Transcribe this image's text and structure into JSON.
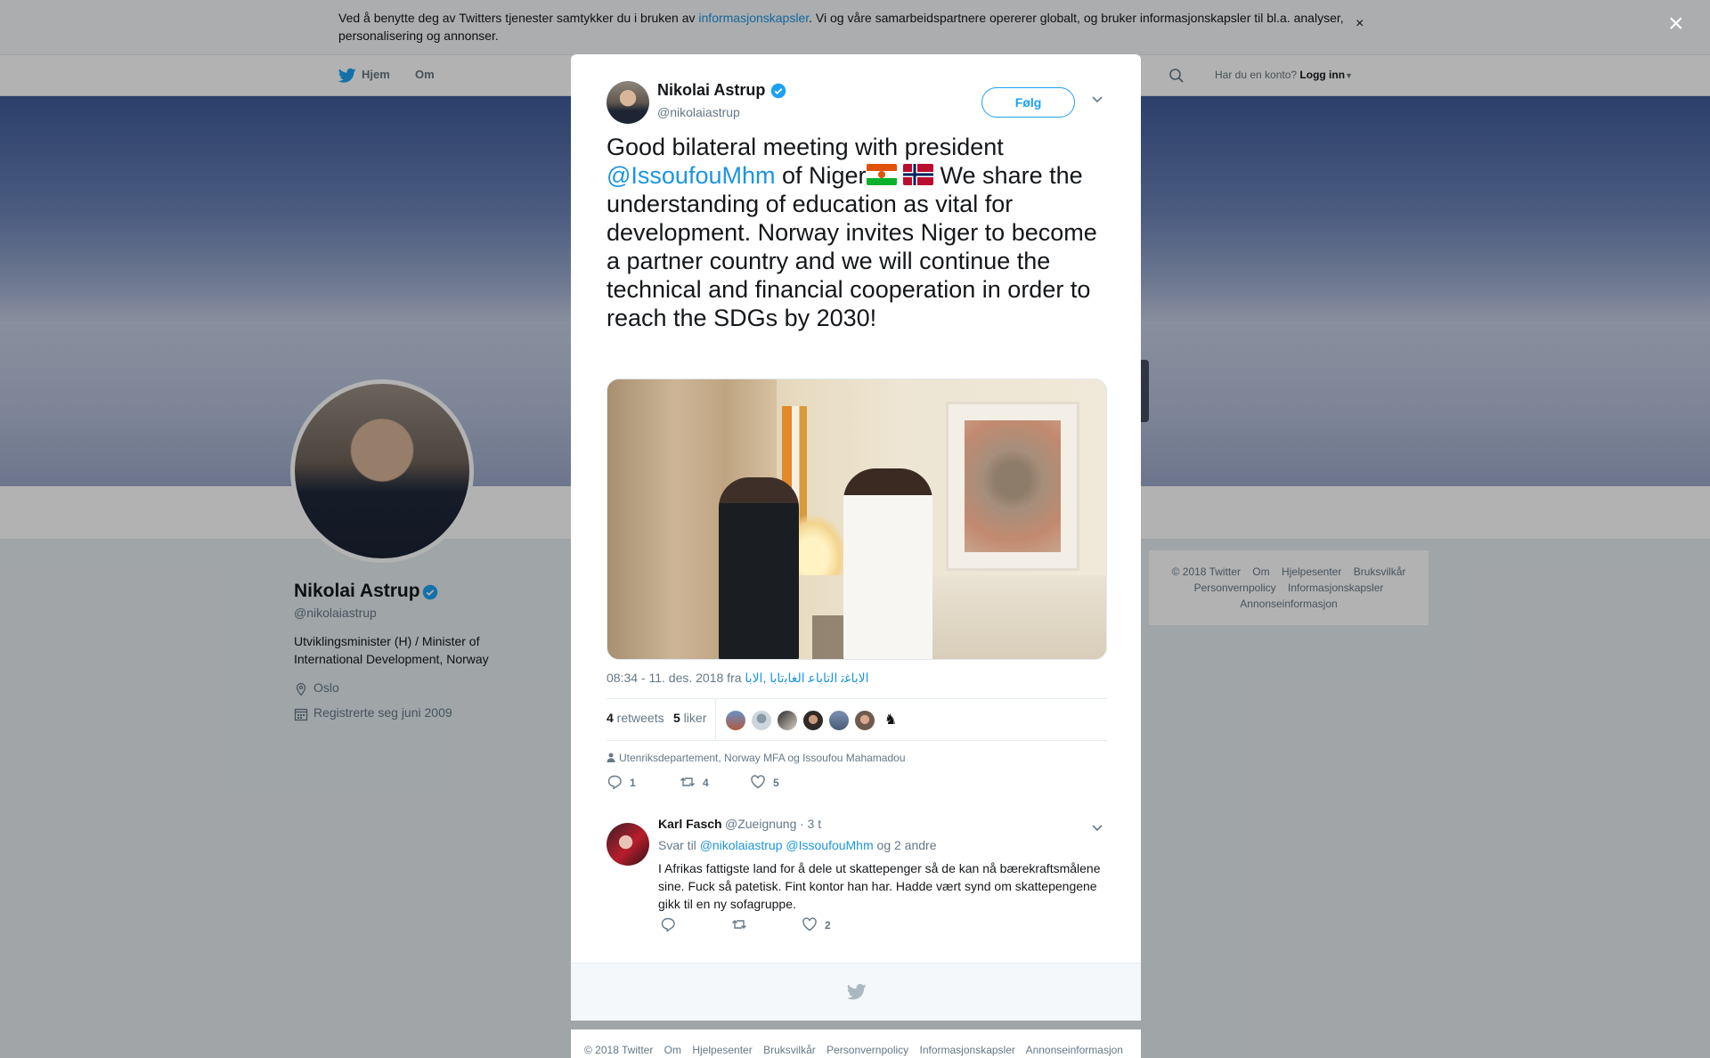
{
  "cookie_bar": {
    "text_before": "Ved å benytte deg av Twitters tjenester samtykker du i bruken av ",
    "link": "informasjonskapsler",
    "text_after": ". Vi og våre samarbeidspartnere opererer globalt, og bruker informasjonskapsler til bl.a. analyser, personalisering og annonser.",
    "close": "×"
  },
  "nav": {
    "home": "Hjem",
    "about": "Om",
    "account_prompt": "Har du en konto?",
    "login": "Logg inn"
  },
  "profile": {
    "name": "Nikolai Astrup",
    "handle": "@nikolaiastrup",
    "bio": "Utviklingsminister (H) / Minister of International Development, Norway",
    "location": "Oslo",
    "joined": "Registrerte seg juni 2009"
  },
  "side_footer": {
    "items": [
      "© 2018 Twitter",
      "Om",
      "Hjelpesenter",
      "Bruksvilkår",
      "Personvernpolicy",
      "Informasjonskapsler",
      "Annonseinformasjon"
    ]
  },
  "overlay_close": "×",
  "tweet": {
    "name": "Nikolai Astrup",
    "handle": "@nikolaiastrup",
    "follow": "Følg",
    "text_1": "Good bilateral meeting with president ",
    "mention": "@IssoufouMhm",
    "text_2": " of Niger",
    "text_3": " We share the understanding of education as vital for development. Norway invites Niger to become a partner country and we will continue the technical and financial cooperation in order to reach the SDGs by 2030!",
    "timestamp": "08:34 - 11. des. 2018 fra ",
    "source": "ﺍﻟﺎﺑﺎﻏﺗ ﺍﻟﺗﺎﺑﺎﻋ ﺍﻟﻐﺎﺑﺗﺎﺑﺎ ,ﺍﻟﺎﺑﺎ",
    "retweets_count": "4",
    "retweets_label": " retweets",
    "likes_count": "5",
    "likes_label": " liker",
    "with": "Utenriksdepartement, Norway MFA og Issoufou Mahamadou",
    "actions": {
      "reply": "1",
      "retweet": "4",
      "like": "5"
    }
  },
  "reply": {
    "name": "Karl Fasch",
    "handle": "@Zueignung",
    "time": "· 3 t",
    "to_prefix": "Svar til ",
    "to_mentions": "@nikolaiastrup @IssoufouMhm",
    "to_suffix": " og 2 andre",
    "text": "I Afrikas fattigste land for å dele ut skattepenger så de kan nå bærekraftsmålene sine. Fuck så patetisk. Fint kontor han har. Hadde vært synd om skattepengene gikk til en ny sofagruppe.",
    "actions": {
      "reply": "",
      "retweet": "",
      "like": "2"
    }
  },
  "modal_footer": {
    "items": [
      "© 2018 Twitter",
      "Om",
      "Hjelpesenter",
      "Bruksvilkår",
      "Personvernpolicy",
      "Informasjonskapsler",
      "Annonseinformasjon"
    ]
  },
  "colors": {
    "twitter_blue": "#1da1f2",
    "link_blue": "#1b95e0",
    "text": "#14171a",
    "muted": "#657786",
    "verified": "#1da1f2"
  },
  "icons": {
    "twitter": "twitter-bird-icon",
    "verified": "verified-badge-icon",
    "reply": "reply-icon",
    "retweet": "retweet-icon",
    "like": "heart-icon",
    "location": "location-pin-icon",
    "calendar": "calendar-icon",
    "search": "search-icon",
    "caret": "chevron-down-icon",
    "person": "person-icon"
  }
}
